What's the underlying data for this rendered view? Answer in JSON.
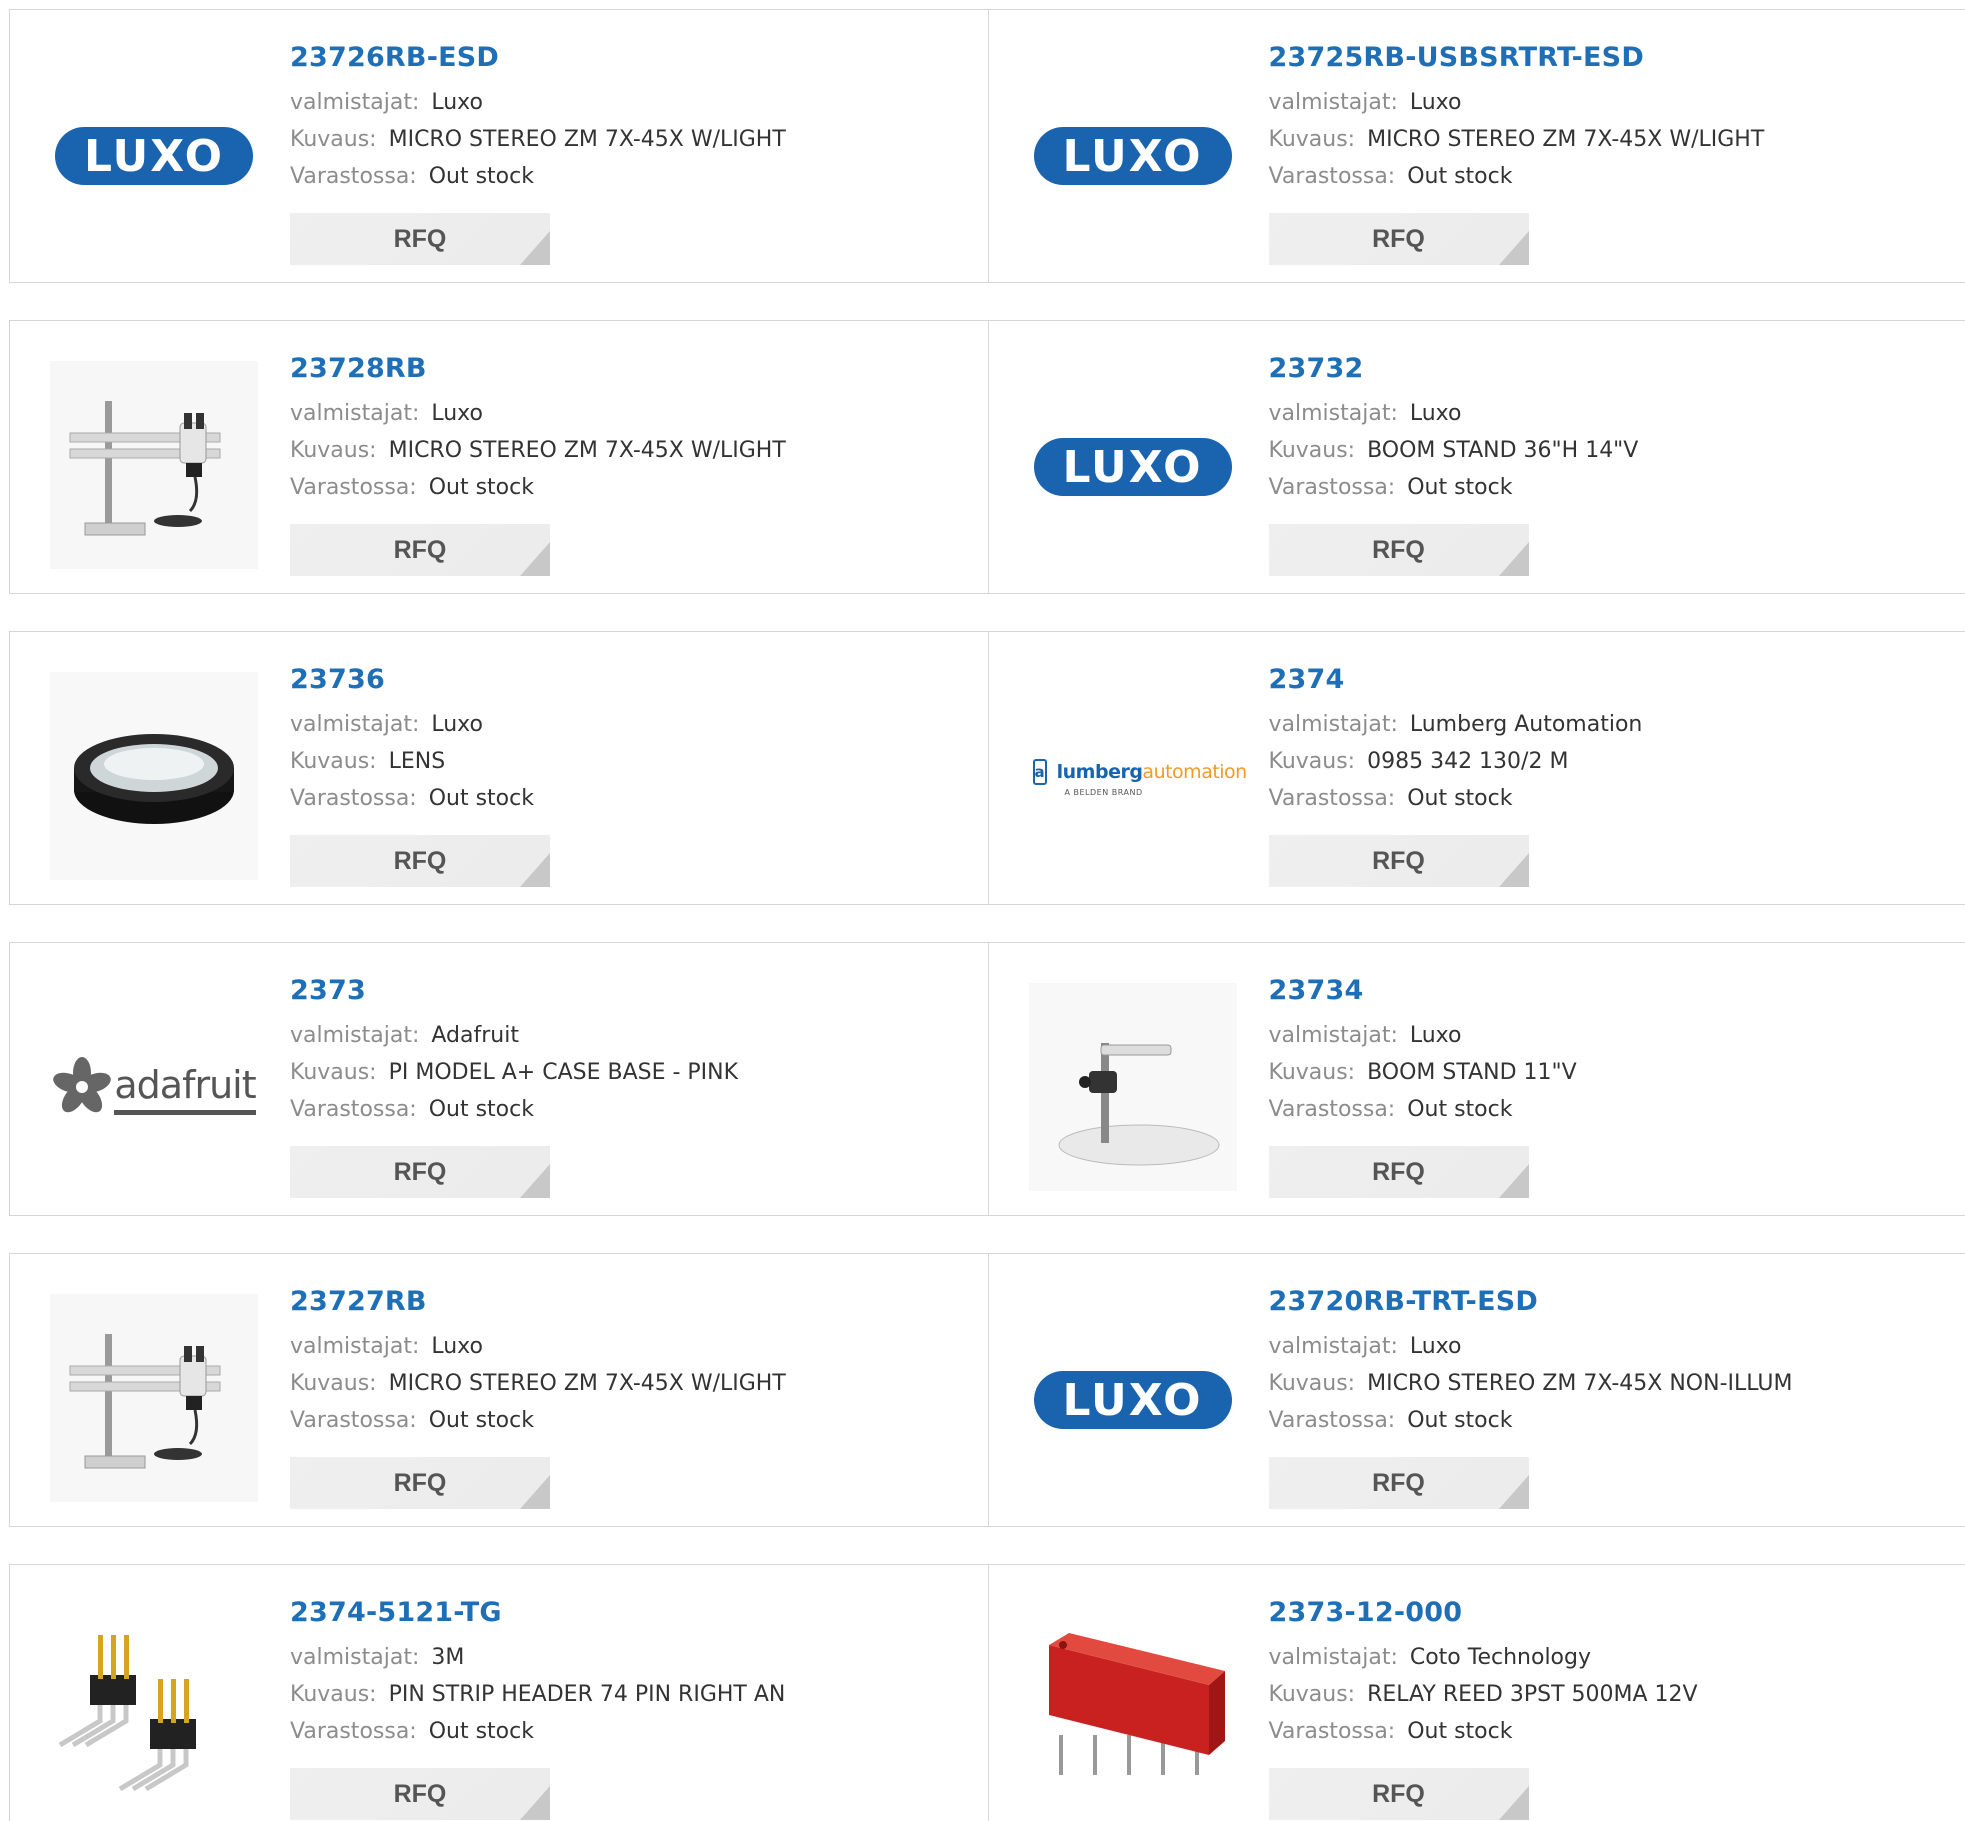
{
  "labels": {
    "manufacturer": "valmistajat:",
    "description": "Kuvaus:",
    "stock": "Varastossa:",
    "rfq": "RFQ"
  },
  "products": [
    {
      "part": "23726RB-ESD",
      "manufacturer": "Luxo",
      "description": "MICRO STEREO ZM 7X-45X W/LIGHT",
      "stock": "Out stock",
      "image": "luxo-logo"
    },
    {
      "part": "23725RB-USBSRTRT-ESD",
      "manufacturer": "Luxo",
      "description": "MICRO STEREO ZM 7X-45X W/LIGHT",
      "stock": "Out stock",
      "image": "luxo-logo"
    },
    {
      "part": "23728RB",
      "manufacturer": "Luxo",
      "description": "MICRO STEREO ZM 7X-45X W/LIGHT",
      "stock": "Out stock",
      "image": "microscope-boom-photo"
    },
    {
      "part": "23732",
      "manufacturer": "Luxo",
      "description": "BOOM STAND 36\"H 14\"V",
      "stock": "Out stock",
      "image": "luxo-logo"
    },
    {
      "part": "23736",
      "manufacturer": "Luxo",
      "description": "LENS",
      "stock": "Out stock",
      "image": "lens-photo"
    },
    {
      "part": "2374",
      "manufacturer": "Lumberg Automation",
      "description": "0985 342 130/2 M",
      "stock": "Out stock",
      "image": "lumberg-logo"
    },
    {
      "part": "2373",
      "manufacturer": "Adafruit",
      "description": "PI MODEL A+ CASE BASE - PINK",
      "stock": "Out stock",
      "image": "adafruit-logo"
    },
    {
      "part": "23734",
      "manufacturer": "Luxo",
      "description": "BOOM STAND 11\"V",
      "stock": "Out stock",
      "image": "boom-stand-photo"
    },
    {
      "part": "23727RB",
      "manufacturer": "Luxo",
      "description": "MICRO STEREO ZM 7X-45X W/LIGHT",
      "stock": "Out stock",
      "image": "microscope-boom-photo"
    },
    {
      "part": "23720RB-TRT-ESD",
      "manufacturer": "Luxo",
      "description": "MICRO STEREO ZM 7X-45X NON-ILLUM",
      "stock": "Out stock",
      "image": "luxo-logo"
    },
    {
      "part": "2374-5121-TG",
      "manufacturer": "3M",
      "description": "PIN STRIP HEADER 74 PIN RIGHT AN",
      "stock": "Out stock",
      "image": "pin-header-photo"
    },
    {
      "part": "2373-12-000",
      "manufacturer": "Coto Technology",
      "description": "RELAY REED 3PST 500MA 12V",
      "stock": "Out stock",
      "image": "reed-relay-photo"
    }
  ],
  "logos": {
    "luxo": "LUXO",
    "lumberg_a": "lumberg",
    "lumberg_b": "automation",
    "lumberg_sub": "A BELDEN BRAND",
    "adafruit": "adafruit"
  },
  "colors": {
    "part_link": "#1f6fb6",
    "label": "#8c8c8c",
    "border": "#d6d6d6",
    "rfq_bg": "#efefef",
    "luxo_blue": "#1a63ae",
    "lumberg_orange": "#f19a28"
  }
}
